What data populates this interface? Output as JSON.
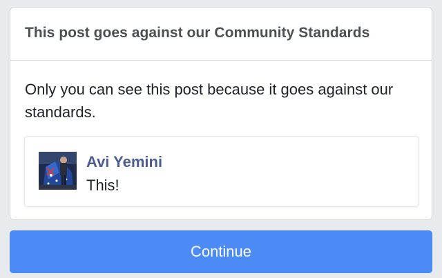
{
  "dialog": {
    "title": "This post goes against our Community Standards",
    "message": "Only you can see this post because it goes against our standards."
  },
  "post": {
    "author": "Avi Yemini",
    "text": "This!",
    "avatar_icon": "profile-photo"
  },
  "actions": {
    "continue_label": "Continue"
  },
  "colors": {
    "page_background": "#e9eaee",
    "card_background": "#ffffff",
    "title_text": "#4b4f56",
    "body_text": "#1d2129",
    "author_name": "#4a5d8c",
    "button_background": "#4c8af6",
    "button_text": "#ffffff"
  }
}
